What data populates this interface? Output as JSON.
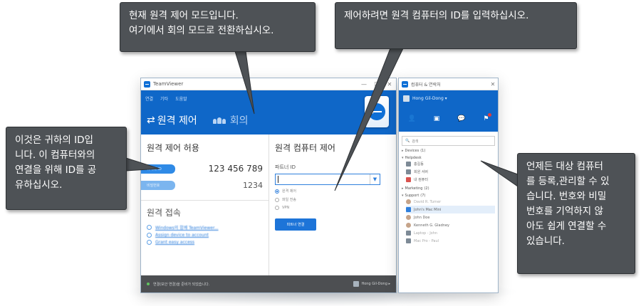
{
  "main_window": {
    "title": "TeamViewer",
    "controls": {
      "minimize": "—",
      "maximize": "☐",
      "close": "✕"
    },
    "menu": [
      "연결",
      "기타",
      "도움말"
    ],
    "tabs": [
      {
        "label": "원격 제어",
        "icon": "arrows-icon",
        "active": true
      },
      {
        "label": "회의",
        "icon": "people-icon",
        "active": false
      }
    ],
    "allow_remote": {
      "title": "원격 제어 허용",
      "id_label": "귀하의 ID",
      "id_value": "123 456 789",
      "password_label": "비밀번호",
      "password_value": "1234"
    },
    "remote_access": {
      "title": "원격 접속",
      "links": [
        "Windows의 함께 TeamViewer...",
        "Assign device to account",
        "Grant easy access"
      ]
    },
    "control_remote": {
      "title": "원격 컴퓨터 제어",
      "partner_label": "파트너 ID",
      "partner_value": "",
      "options": [
        "원격 제어",
        "파일 전송",
        "VPN"
      ],
      "selected_option": 0,
      "connect_button": "파트너 연결"
    },
    "status": {
      "text": "연결(보안 연결)을 준비가 되었습니다.",
      "user": "Hong Gil-Dong ▸"
    }
  },
  "contacts_window": {
    "title": "컴퓨터 & 연락처",
    "user": "Hong Gil-Dong ▾",
    "search_placeholder": "검색",
    "groups": [
      {
        "name": "Devices",
        "count": "(1)",
        "items": []
      },
      {
        "name": "Helpdesk",
        "count": "",
        "items": [
          {
            "name": "홍길동",
            "icon": "computer"
          },
          {
            "name": "회원 서버",
            "icon": "computer"
          },
          {
            "name": "내 컴퓨터",
            "icon": "computer-red"
          }
        ]
      },
      {
        "name": "Marketing",
        "count": "(2)",
        "items": []
      },
      {
        "name": "Support",
        "count": "(7)",
        "items": [
          {
            "name": "David R. Turner",
            "icon": "face",
            "dim": true
          },
          {
            "name": "John's Mac Mini",
            "icon": "blue",
            "selected": true
          },
          {
            "name": "John Doe",
            "icon": "face"
          },
          {
            "name": "Kenneth G. Gladney",
            "icon": "face"
          },
          {
            "name": "Laptop - John",
            "icon": "computer",
            "dim": true
          },
          {
            "name": "Mac Pro - Paul",
            "icon": "computer",
            "dim": true
          }
        ]
      }
    ]
  },
  "callouts": {
    "mode": "현재 원격 제어 모드입니다.\n여기에서 회의 모드로 전환하십시오.",
    "enter_id": "제어하려면 원격 컴퓨터의 ID를 입력하십시오.",
    "your_id": "이것은 귀하의 ID입\n니다. 이 컴퓨터와의\n연결을 위해 ID를 공\n유하십시오.",
    "contacts": "언제든 대상 컴퓨터\n를 등록,관리할 수 있\n습니다. 번호와 비밀\n번호를 기억하지 않\n아도 쉽게 연결할 수\n있습니다."
  },
  "colors": {
    "brand_blue": "#0f67c8",
    "callout_bg": "#4e5256",
    "status_bar": "#4d4f52"
  }
}
